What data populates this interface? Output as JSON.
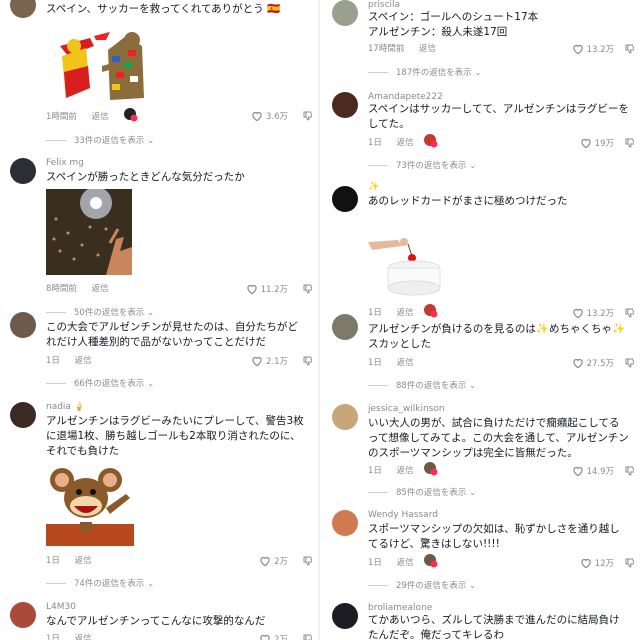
{
  "left": {
    "c1": {
      "text": [
        "スペイン、サッカーを救ってくれてありがとう 🇪🇸"
      ],
      "time": "1時間前",
      "reply": "返信",
      "likes": "3.6万",
      "more": "33件の返信を表示"
    },
    "c2": {
      "user": "Felix mg",
      "text": [
        "スペインが勝ったときどんな気分だったか"
      ],
      "time": "8時間前",
      "reply": "返信",
      "likes": "11.2万",
      "more": "50件の返信を表示"
    },
    "c3": {
      "text": [
        "この大会でアルゼンチンが見せたのは、自分たちがど",
        "れだけ人種差別的で品がないかってことだけだ"
      ],
      "time": "1日",
      "reply": "返信",
      "likes": "2.1万",
      "more": "66件の返信を表示"
    },
    "c4": {
      "user": "nadia 🍦",
      "text": [
        "アルゼンチンはラグビーみたいにプレーして、警告3枚",
        "に退場1枚、勝ち越しゴールも2本取り消されたのに、",
        "それでも負けた"
      ],
      "time": "1日",
      "reply": "返信",
      "likes": "2万",
      "more": "74件の返信を表示"
    },
    "c5": {
      "user": "L4M30",
      "text": [
        "なんでアルゼンチンってこんなに攻撃的なんだ"
      ],
      "time": "1日",
      "reply": "返信",
      "likes": "2万"
    }
  },
  "right": {
    "c1": {
      "user": "priscila",
      "text": [
        "スペイン：ゴールへのシュート17本",
        "アルゼンチン：殺人未遂17回"
      ],
      "time": "17時間前",
      "reply": "返信",
      "likes": "13.2万",
      "more": "187件の返信を表示"
    },
    "c2": {
      "user": "Amandapete222",
      "text": [
        "スペインはサッカーしてて、アルゼンチンはラグビーを",
        "してた。"
      ],
      "time": "1日",
      "reply": "返信",
      "likes": "19万",
      "more": "73件の返信を表示"
    },
    "c3": {
      "user": "✨",
      "text": [
        "あのレッドカードがまさに極めつけだった"
      ],
      "time": "1日",
      "reply": "返信",
      "likes": "13.2万"
    },
    "c4": {
      "text": [
        "アルゼンチンが負けるのを見るのは✨めちゃくちゃ✨",
        "スカッとした"
      ],
      "time": "1日",
      "reply": "返信",
      "likes": "27.5万",
      "more": "88件の返信を表示"
    },
    "c5": {
      "user": "jessica_wilkinson",
      "text": [
        "いい大人の男が、試合に負けただけで癇癪起こしてる",
        "って想像してみてよ。この大会を通して、アルゼンチン",
        "のスポーツマンシップは完全に皆無だった。"
      ],
      "time": "1日",
      "reply": "返信",
      "likes": "14.9万",
      "more": "85件の返信を表示"
    },
    "c6": {
      "user": "Wendy Hassard",
      "text": [
        "スポーツマンシップの欠如は、恥ずかしさを通り越し",
        "てるけど、驚きはしない!!!!"
      ],
      "time": "1日",
      "reply": "返信",
      "likes": "12万",
      "more": "29件の返信を表示"
    },
    "c7": {
      "user": "broliamealone",
      "text": [
        "てかあいつら、ズルして決勝まで進んだのに結局負け",
        "たんだぞ。俺だってキレるわ"
      ]
    }
  },
  "colors": {
    "text": "#161823",
    "muted": "#8a8b91",
    "like_badge": "#fe2c55"
  },
  "icons": {
    "like": "heart-outline-icon",
    "dislike": "thumbs-down-icon",
    "expand": "chevron-down-icon"
  }
}
